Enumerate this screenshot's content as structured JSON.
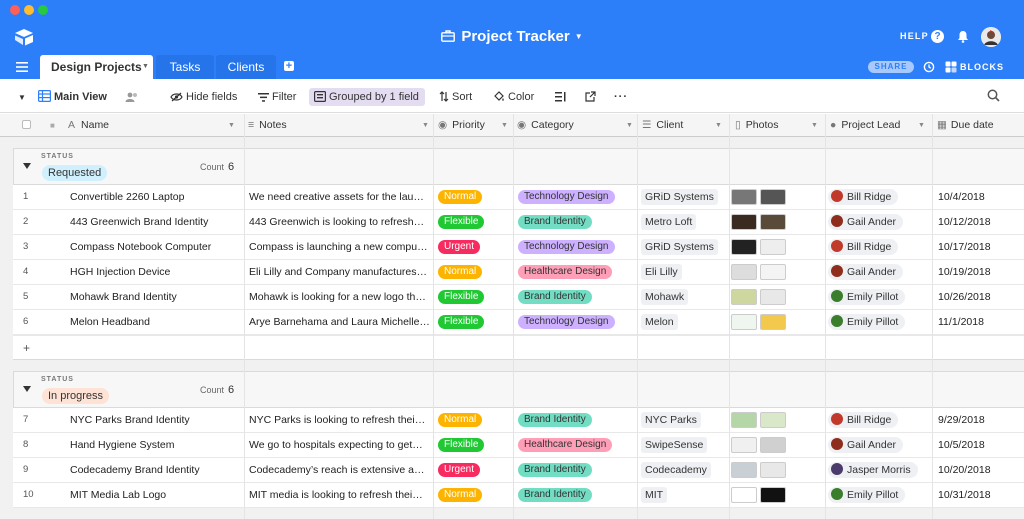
{
  "app": {
    "title": "Project Tracker",
    "help_label": "HELP",
    "share_label": "SHARE",
    "blocks_label": "BLOCKS"
  },
  "tabs": [
    {
      "label": "Design Projects"
    },
    {
      "label": "Tasks"
    },
    {
      "label": "Clients"
    }
  ],
  "toolbar": {
    "view_name": "Main View",
    "hide_fields": "Hide fields",
    "filter": "Filter",
    "grouped": "Grouped by 1 field",
    "sort": "Sort",
    "color": "Color"
  },
  "columns": {
    "name": "Name",
    "notes": "Notes",
    "priority": "Priority",
    "category": "Category",
    "client": "Client",
    "photos": "Photos",
    "project_lead": "Project Lead",
    "due_date": "Due date"
  },
  "colors": {
    "accent": "#2d7ff9",
    "normal": "#fcb400",
    "flexible": "#20c933",
    "urgent": "#f82b60",
    "technology_design": "#cdb0ff",
    "brand_identity": "#72ddc3",
    "healthcare_design": "#ff9eb7"
  },
  "groups": [
    {
      "status_label": "STATUS",
      "status": "Requested",
      "status_color": "#d0f0fd",
      "count_label": "Count",
      "count": "6",
      "rows": [
        {
          "num": "1",
          "name": "Convertible 2260 Laptop",
          "notes": "We need creative assets for the lau…",
          "priority": "Normal",
          "category": "Technology Design",
          "client": "GRiD Systems",
          "lead": "Bill Ridge",
          "due": "10/4/2018"
        },
        {
          "num": "2",
          "name": "443 Greenwich Brand Identity",
          "notes": "443 Greenwich is looking to refresh…",
          "priority": "Flexible",
          "category": "Brand Identity",
          "client": "Metro Loft",
          "lead": "Gail Ander",
          "due": "10/12/2018"
        },
        {
          "num": "3",
          "name": "Compass Notebook Computer",
          "notes": "Compass is launching a new compu…",
          "priority": "Urgent",
          "category": "Technology Design",
          "client": "GRiD Systems",
          "lead": "Bill Ridge",
          "due": "10/17/2018"
        },
        {
          "num": "4",
          "name": "HGH Injection Device",
          "notes": "Eli Lilly and Company manufactures…",
          "priority": "Normal",
          "category": "Healthcare Design",
          "client": "Eli Lilly",
          "lead": "Gail Ander",
          "due": "10/19/2018"
        },
        {
          "num": "5",
          "name": "Mohawk Brand Identity",
          "notes": "Mohawk is looking for a new logo th…",
          "priority": "Flexible",
          "category": "Brand Identity",
          "client": "Mohawk",
          "lead": "Emily Pillot",
          "due": "10/26/2018"
        },
        {
          "num": "6",
          "name": "Melon Headband",
          "notes": "Arye Barnehama and Laura Michelle…",
          "priority": "Flexible",
          "category": "Technology Design",
          "client": "Melon",
          "lead": "Emily Pillot",
          "due": "11/1/2018"
        }
      ]
    },
    {
      "status_label": "STATUS",
      "status": "In progress",
      "status_color": "#fee2d5",
      "count_label": "Count",
      "count": "6",
      "rows": [
        {
          "num": "7",
          "name": "NYC Parks Brand Identity",
          "notes": "NYC Parks is looking to refresh thei…",
          "priority": "Normal",
          "category": "Brand Identity",
          "client": "NYC Parks",
          "lead": "Bill Ridge",
          "due": "9/29/2018"
        },
        {
          "num": "8",
          "name": "Hand Hygiene System",
          "notes": "We go to hospitals expecting to get…",
          "priority": "Flexible",
          "category": "Healthcare Design",
          "client": "SwipeSense",
          "lead": "Gail Ander",
          "due": "10/5/2018"
        },
        {
          "num": "9",
          "name": "Codecademy Brand Identity",
          "notes": "Codecademy’s reach is extensive a…",
          "priority": "Urgent",
          "category": "Brand Identity",
          "client": "Codecademy",
          "lead": "Jasper Morris",
          "due": "10/20/2018"
        },
        {
          "num": "10",
          "name": "MIT Media Lab Logo",
          "notes": "MIT media is looking to refresh thei…",
          "priority": "Normal",
          "category": "Brand Identity",
          "client": "MIT",
          "lead": "Emily Pillot",
          "due": "10/31/2018"
        }
      ]
    }
  ],
  "add_row_label": "+"
}
